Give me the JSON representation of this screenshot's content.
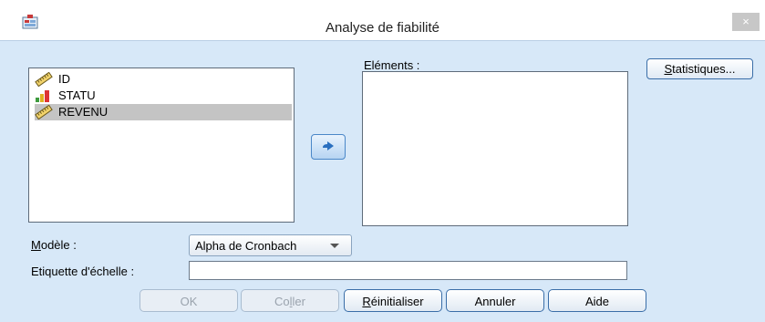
{
  "window": {
    "title": "Analyse de fiabilité",
    "close_glyph": "×"
  },
  "variables": [
    {
      "name": "ID",
      "icon": "ruler-scale-icon",
      "selected": false
    },
    {
      "name": "STATU",
      "icon": "bar-chart-ordinal-icon",
      "selected": false
    },
    {
      "name": "REVENU",
      "icon": "ruler-scale-icon",
      "selected": true
    }
  ],
  "elements": {
    "label": "Eléments :",
    "items": []
  },
  "buttons": {
    "statistiques": "Statistiques...",
    "ok": "OK",
    "coller": "Coller",
    "reinitialiser": "Réinitialiser",
    "annuler": "Annuler",
    "aide": "Aide"
  },
  "modele": {
    "label": "Modèle :",
    "value": "Alpha de Cronbach"
  },
  "echelle": {
    "label": "Etiquette d'échelle :",
    "value": ""
  },
  "colors": {
    "client_bg": "#d7e8f8",
    "selected_row": "#c4c4c4",
    "button_border": "#3a6ea8"
  }
}
